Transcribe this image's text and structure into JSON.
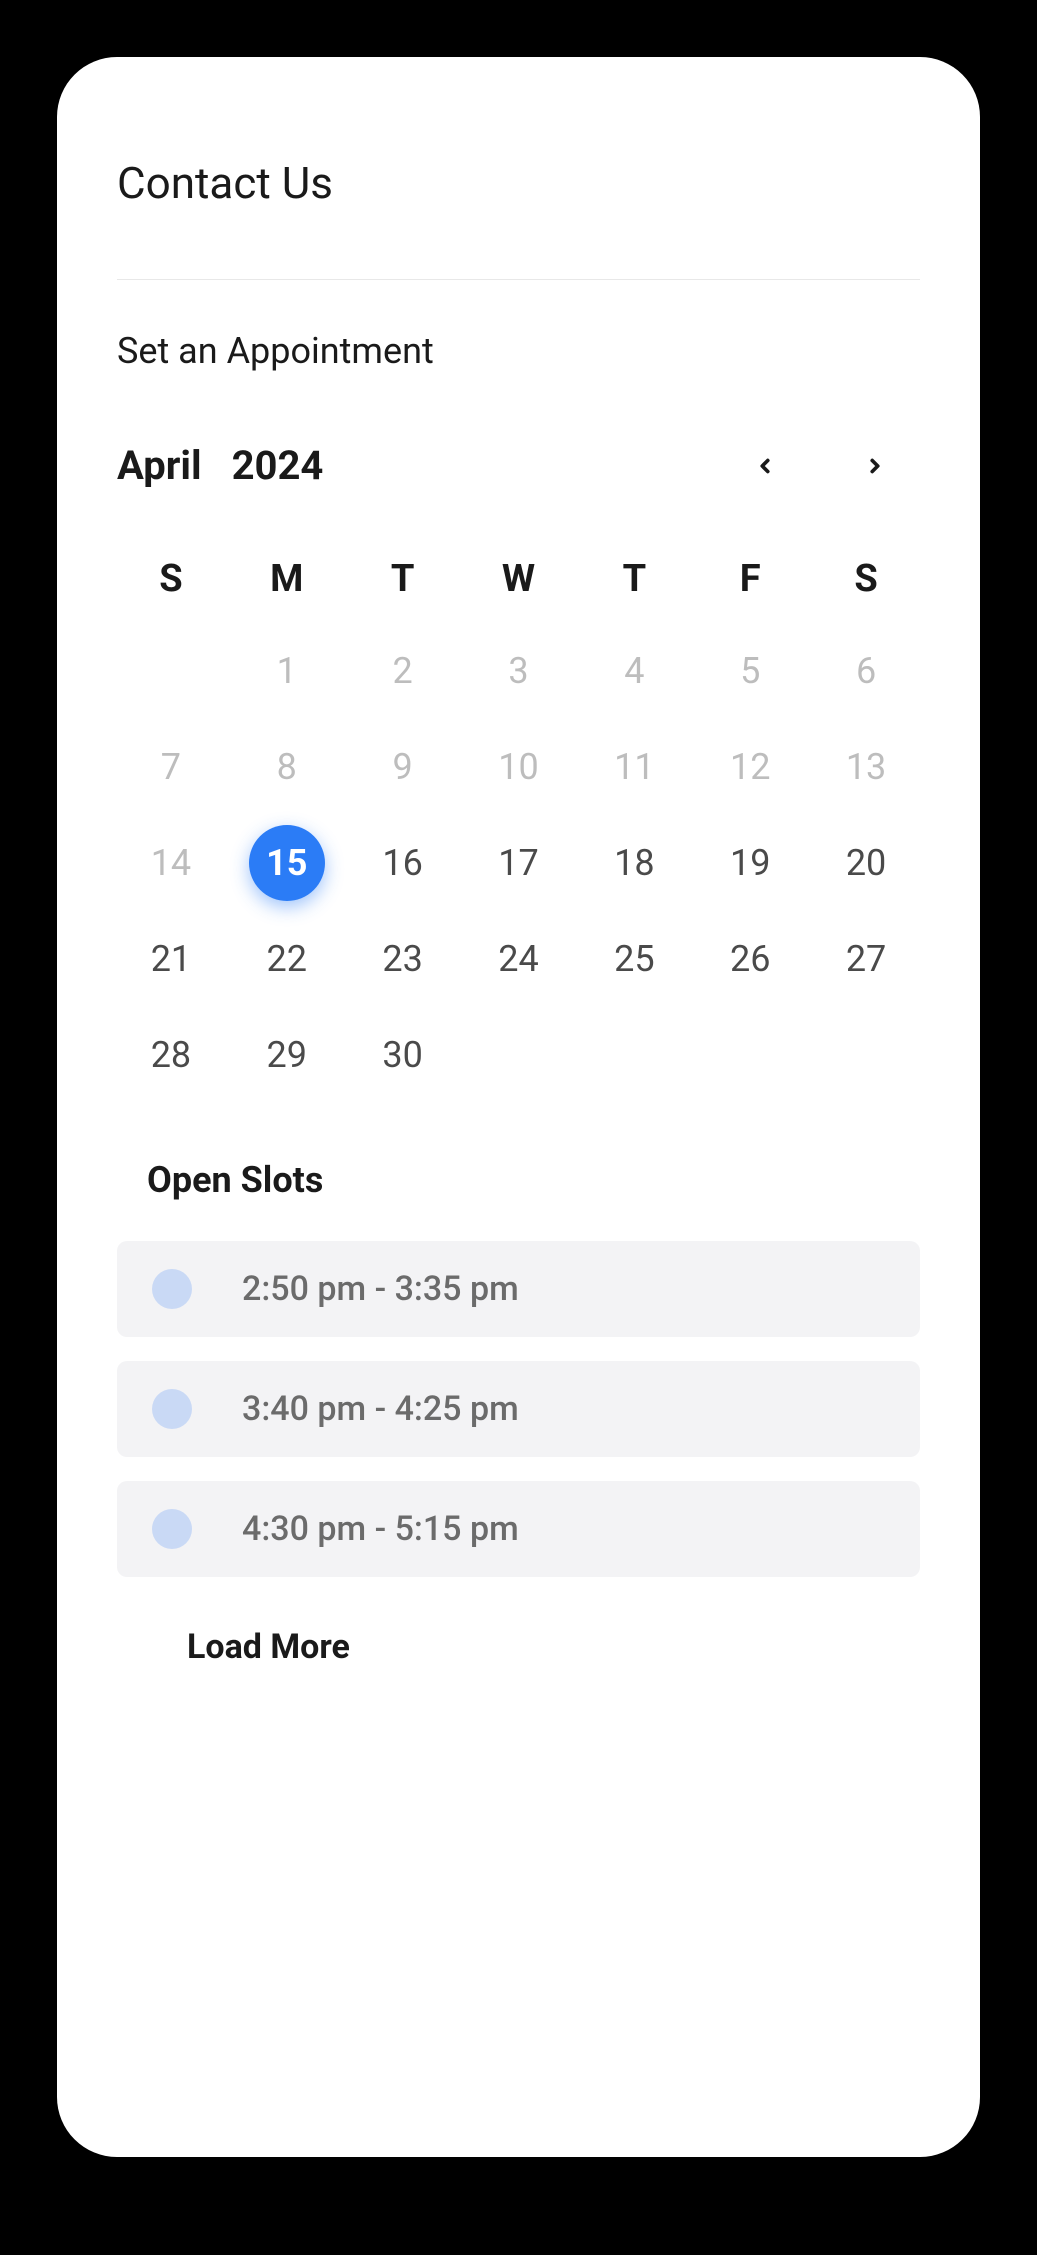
{
  "header": {
    "title": "Contact Us",
    "subtitle": "Set an Appointment"
  },
  "calendar": {
    "month": "April",
    "year": "2024",
    "day_headers": [
      "S",
      "M",
      "T",
      "W",
      "T",
      "F",
      "S"
    ],
    "selected_day": 15,
    "days": [
      {
        "num": "",
        "state": "empty"
      },
      {
        "num": "1",
        "state": "muted"
      },
      {
        "num": "2",
        "state": "muted"
      },
      {
        "num": "3",
        "state": "muted"
      },
      {
        "num": "4",
        "state": "muted"
      },
      {
        "num": "5",
        "state": "muted"
      },
      {
        "num": "6",
        "state": "muted"
      },
      {
        "num": "7",
        "state": "muted"
      },
      {
        "num": "8",
        "state": "muted"
      },
      {
        "num": "9",
        "state": "muted"
      },
      {
        "num": "10",
        "state": "muted"
      },
      {
        "num": "11",
        "state": "muted"
      },
      {
        "num": "12",
        "state": "muted"
      },
      {
        "num": "13",
        "state": "muted"
      },
      {
        "num": "14",
        "state": "muted"
      },
      {
        "num": "15",
        "state": "selected"
      },
      {
        "num": "16",
        "state": "normal"
      },
      {
        "num": "17",
        "state": "normal"
      },
      {
        "num": "18",
        "state": "normal"
      },
      {
        "num": "19",
        "state": "normal"
      },
      {
        "num": "20",
        "state": "normal"
      },
      {
        "num": "21",
        "state": "normal"
      },
      {
        "num": "22",
        "state": "normal"
      },
      {
        "num": "23",
        "state": "normal"
      },
      {
        "num": "24",
        "state": "normal"
      },
      {
        "num": "25",
        "state": "normal"
      },
      {
        "num": "26",
        "state": "normal"
      },
      {
        "num": "27",
        "state": "normal"
      },
      {
        "num": "28",
        "state": "normal"
      },
      {
        "num": "29",
        "state": "normal"
      },
      {
        "num": "30",
        "state": "normal"
      }
    ]
  },
  "slots": {
    "heading": "Open Slots",
    "items": [
      {
        "label": "2:50 pm - 3:35 pm"
      },
      {
        "label": "3:40 pm - 4:25 pm"
      },
      {
        "label": "4:30 pm - 5:15 pm"
      }
    ],
    "load_more_label": "Load More"
  },
  "colors": {
    "accent": "#2B7CF6",
    "slot_bg": "#f3f3f5",
    "slot_dot": "#c9d9f5",
    "muted_text": "#bdbdbd"
  }
}
